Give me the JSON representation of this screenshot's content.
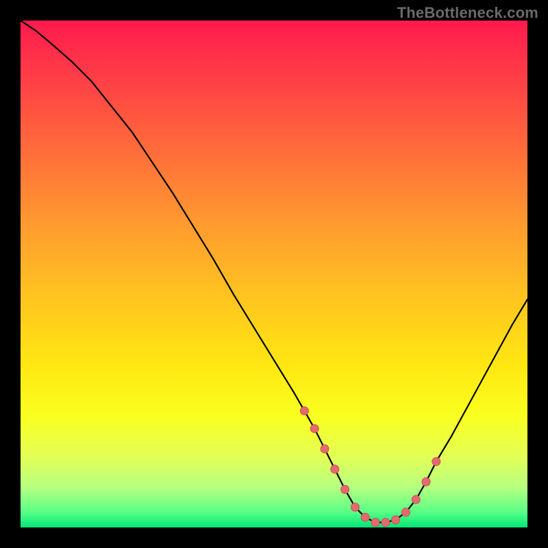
{
  "watermark": "TheBottleneck.com",
  "colors": {
    "marker_fill": "#e46a6f",
    "marker_stroke": "#c94e56",
    "curve_stroke": "#000000"
  },
  "chart_data": {
    "type": "line",
    "title": "",
    "xlabel": "",
    "ylabel": "",
    "xlim": [
      0,
      100
    ],
    "ylim": [
      0,
      100
    ],
    "series": [
      {
        "name": "bottleneck-curve",
        "x": [
          0,
          3,
          6,
          10,
          14,
          18,
          22,
          26,
          30,
          34,
          38,
          42,
          46,
          50,
          54,
          56,
          58,
          60,
          62,
          64,
          66,
          68,
          70,
          72,
          74,
          76,
          78,
          80,
          82,
          85,
          88,
          91,
          94,
          97,
          100
        ],
        "y": [
          100,
          98,
          95.5,
          92,
          88,
          83,
          78,
          72,
          66,
          59.5,
          53,
          46,
          39.5,
          33,
          26.5,
          23,
          19.5,
          15.5,
          11.5,
          7.5,
          4,
          2,
          1,
          1,
          1.5,
          3,
          5.5,
          9,
          13,
          18,
          23.5,
          29,
          34.5,
          40,
          45
        ]
      }
    ],
    "markers": {
      "series": "bottleneck-curve",
      "x": [
        56,
        58,
        60,
        62,
        64,
        66,
        68,
        70,
        72,
        74,
        76,
        78,
        80,
        82
      ],
      "y": [
        23,
        19.5,
        15.5,
        11.5,
        7.5,
        4,
        2,
        1,
        1,
        1.5,
        3,
        5.5,
        9,
        13
      ],
      "radius": 6
    }
  }
}
